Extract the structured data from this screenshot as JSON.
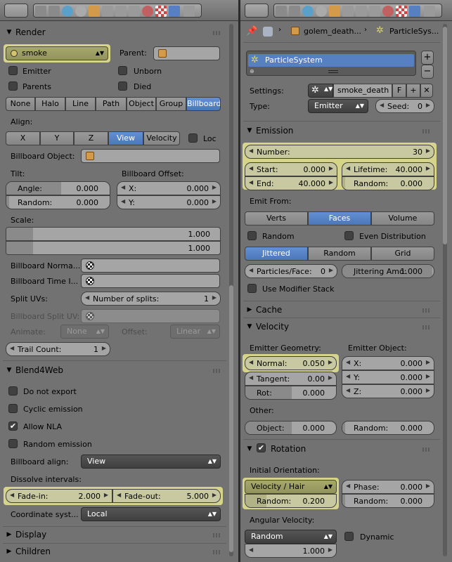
{
  "colors": {
    "highlight": "#c8c9a0",
    "accent": "#5680c2"
  },
  "left": {
    "render": {
      "title": "Render",
      "material": "smoke",
      "parent_label": "Parent:",
      "emitter": "Emitter",
      "unborn": "Unborn",
      "parents": "Parents",
      "died": "Died",
      "modes": [
        "None",
        "Halo",
        "Line",
        "Path",
        "Object",
        "Group",
        "Billboard"
      ],
      "align_label": "Align:",
      "align": [
        "X",
        "Y",
        "Z",
        "View",
        "Velocity"
      ],
      "loc": "Loc",
      "billboard_object": "Billboard Object:",
      "tilt": "Tilt:",
      "billboard_offset": "Billboard Offset:",
      "angle": {
        "label": "Angle:",
        "value": "0.000"
      },
      "tilt_random": {
        "label": "Random:",
        "value": "0.000"
      },
      "off_x": {
        "label": "X:",
        "value": "0.000"
      },
      "off_y": {
        "label": "Y:",
        "value": "0.000"
      },
      "scale": "Scale:",
      "scale_1": "1.000",
      "scale_2": "1.000",
      "billboard_normal": "Billboard Norma...",
      "billboard_time": "Billboard Time I...",
      "split_uvs": "Split UVs:",
      "num_splits": {
        "label": "Number of splits:",
        "value": "1"
      },
      "billboard_split_uv": "Billboard Split UV:",
      "animate": "Animate:",
      "animate_value": "None",
      "offset": "Offset:",
      "offset_value": "Linear",
      "trail_count": {
        "label": "Trail Count:",
        "value": "1"
      }
    },
    "b4w": {
      "title": "Blend4Web",
      "do_not_export": "Do not export",
      "cyclic_emission": "Cyclic emission",
      "allow_nla": "Allow NLA",
      "random_emission": "Random emission",
      "billboard_align": "Billboard align:",
      "billboard_align_value": "View",
      "dissolve": "Dissolve intervals:",
      "fade_in": {
        "label": "Fade-in:",
        "value": "2.000"
      },
      "fade_out": {
        "label": "Fade-out:",
        "value": "5.000"
      },
      "coord": "Coordinate syst...",
      "coord_value": "Local"
    },
    "display": "Display",
    "children": "Children"
  },
  "right": {
    "breadcrumb": {
      "obj": "golem_death...",
      "ps": "ParticleSys..."
    },
    "list_item": "ParticleSystem",
    "settings_label": "Settings:",
    "settings_value": "smoke_death",
    "f": "F",
    "type_label": "Type:",
    "type_value": "Emitter",
    "seed": {
      "label": "Seed:",
      "value": "0"
    },
    "emission": {
      "title": "Emission",
      "number": {
        "label": "Number:",
        "value": "30"
      },
      "start": {
        "label": "Start:",
        "value": "0.000"
      },
      "end": {
        "label": "End:",
        "value": "40.000"
      },
      "lifetime": {
        "label": "Lifetime:",
        "value": "40.000"
      },
      "random": {
        "label": "Random:",
        "value": "0.000"
      },
      "emit_from": "Emit From:",
      "sources": [
        "Verts",
        "Faces",
        "Volume"
      ],
      "random_cb": "Random",
      "even": "Even Distribution",
      "dist": [
        "Jittered",
        "Random",
        "Grid"
      ],
      "ppf": {
        "label": "Particles/Face:",
        "value": "0"
      },
      "jitter": {
        "label": "Jittering Amo:",
        "value": "1.000"
      },
      "modstack": "Use Modifier Stack"
    },
    "cache": "Cache",
    "velocity": {
      "title": "Velocity",
      "emitter_geom": "Emitter Geometry:",
      "emitter_obj": "Emitter Object:",
      "normal": {
        "label": "Normal:",
        "value": "0.050"
      },
      "tangent": {
        "label": "Tangent:",
        "value": "0.00"
      },
      "rot": {
        "label": "Rot:",
        "value": "0.000"
      },
      "x": {
        "label": "X:",
        "value": "0.000"
      },
      "y": {
        "label": "Y:",
        "value": "0.000"
      },
      "z": {
        "label": "Z:",
        "value": "0.000"
      },
      "other": "Other:",
      "object": {
        "label": "Object:",
        "value": "0.000"
      },
      "random": {
        "label": "Random:",
        "value": "0.000"
      }
    },
    "rotation": {
      "title": "Rotation",
      "initial": "Initial Orientation:",
      "orient": "Velocity / Hair",
      "orient_random": {
        "label": "Random:",
        "value": "0.200"
      },
      "phase": {
        "label": "Phase:",
        "value": "0.000"
      },
      "phase_random": {
        "label": "Random:",
        "value": "0.000"
      },
      "angular": "Angular Velocity:",
      "ang_mode": "Random",
      "ang_value": "1.000",
      "dynamic": "Dynamic"
    }
  }
}
